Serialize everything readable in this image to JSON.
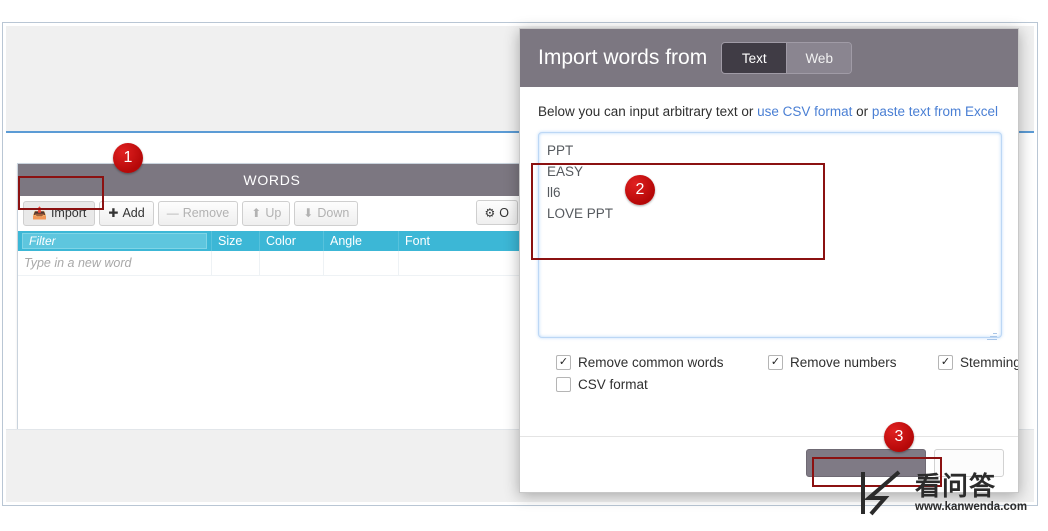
{
  "app": {
    "words_panel": {
      "title": "WORDS",
      "toolbar": [
        {
          "label": "Import",
          "icon": "import-icon",
          "state": "active",
          "enabled": true
        },
        {
          "label": "Add",
          "icon": "plus-icon",
          "state": "normal",
          "enabled": true
        },
        {
          "label": "Remove",
          "icon": "minus-icon",
          "state": "disabled",
          "enabled": false
        },
        {
          "label": "Up",
          "icon": "arrow-up-icon",
          "state": "disabled",
          "enabled": false
        },
        {
          "label": "Down",
          "icon": "arrow-down-icon",
          "state": "disabled",
          "enabled": false
        }
      ],
      "options_button": {
        "label": "O",
        "icon": "gear-icon"
      },
      "columns": [
        "Filter",
        "Size",
        "Color",
        "Angle",
        "Font"
      ],
      "filter_placeholder": "Filter",
      "new_word_placeholder": "Type in a new word",
      "rows": []
    }
  },
  "modal": {
    "title": "Import words from",
    "tabs": [
      {
        "label": "Text",
        "selected": true
      },
      {
        "label": "Web",
        "selected": false
      }
    ],
    "description": {
      "part1": "Below you can input arbitrary text or ",
      "link1": "use CSV format",
      "part2": " or ",
      "link2": "paste text from Excel"
    },
    "textarea": {
      "value": "PPT\nEASY\nll6\nLOVE PPT",
      "placeholder": ""
    },
    "checkboxes": [
      {
        "label": "Remove common words",
        "checked": true
      },
      {
        "label": "Remove numbers",
        "checked": true
      },
      {
        "label": "Stemming",
        "checked": true
      },
      {
        "label": "CSV format",
        "checked": false
      }
    ],
    "footer": {
      "primary_label": "",
      "secondary_label": ""
    }
  },
  "annotations": [
    {
      "number": "1",
      "target": "import-button"
    },
    {
      "number": "2",
      "target": "import-textarea"
    },
    {
      "number": "3",
      "target": "modal-primary-button"
    }
  ],
  "watermark": {
    "name": "看问答",
    "url": "www.kanwenda.com"
  },
  "colors": {
    "header_gray": "#7c7781",
    "table_cyan": "#3cb7d6",
    "link_blue": "#4a7fd4",
    "annotation_red": "#b50808",
    "accent_blue": "#5b9bd5"
  }
}
